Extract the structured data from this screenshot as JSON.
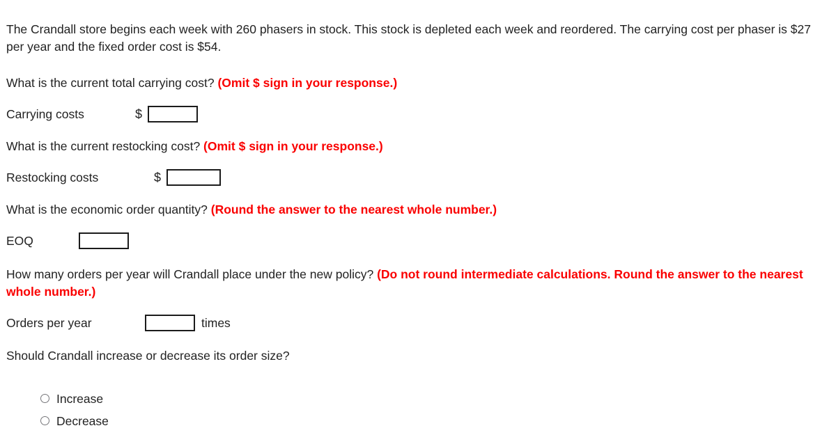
{
  "problem": {
    "intro": "The Crandall store begins each week with 260 phasers in stock. This stock is depleted each week and reordered. The carrying cost per phaser is $27 per year and the fixed order cost is $54."
  },
  "accent": {
    "hint_color": "#fa0000",
    "text_color": "#222222",
    "field_border_color": "#1b1b1b",
    "radio_border_color": "#76767a"
  },
  "questions": [
    {
      "text": "What is the current total carrying cost? ",
      "hint": "(Omit $ sign in your response.)",
      "answer_label": "Carrying costs",
      "currency": "$",
      "value": "",
      "placeholder": "",
      "suffix": ""
    },
    {
      "text": "What is the current restocking cost? ",
      "hint": "(Omit $ sign in your response.)",
      "answer_label": "Restocking costs",
      "currency": "$",
      "value": "",
      "placeholder": "",
      "suffix": ""
    },
    {
      "text": "What is the economic order quantity? ",
      "hint": "(Round the answer to the nearest whole number.)",
      "answer_label": "EOQ",
      "currency": "",
      "value": "",
      "placeholder": "",
      "suffix": ""
    },
    {
      "text": "How many orders per year will Crandall place under the new policy? ",
      "hint": "(Do not round intermediate calculations. Round the answer to the nearest whole number.)",
      "answer_label": "Orders per year",
      "currency": "",
      "value": "",
      "placeholder": "",
      "suffix": "times"
    },
    {
      "text": "Should Crandall increase or decrease its order size?",
      "hint": "",
      "answer_label": "",
      "currency": "",
      "value": "",
      "placeholder": "",
      "suffix": ""
    }
  ],
  "choices": [
    {
      "label": "Increase",
      "selected": false
    },
    {
      "label": "Decrease",
      "selected": false
    }
  ]
}
